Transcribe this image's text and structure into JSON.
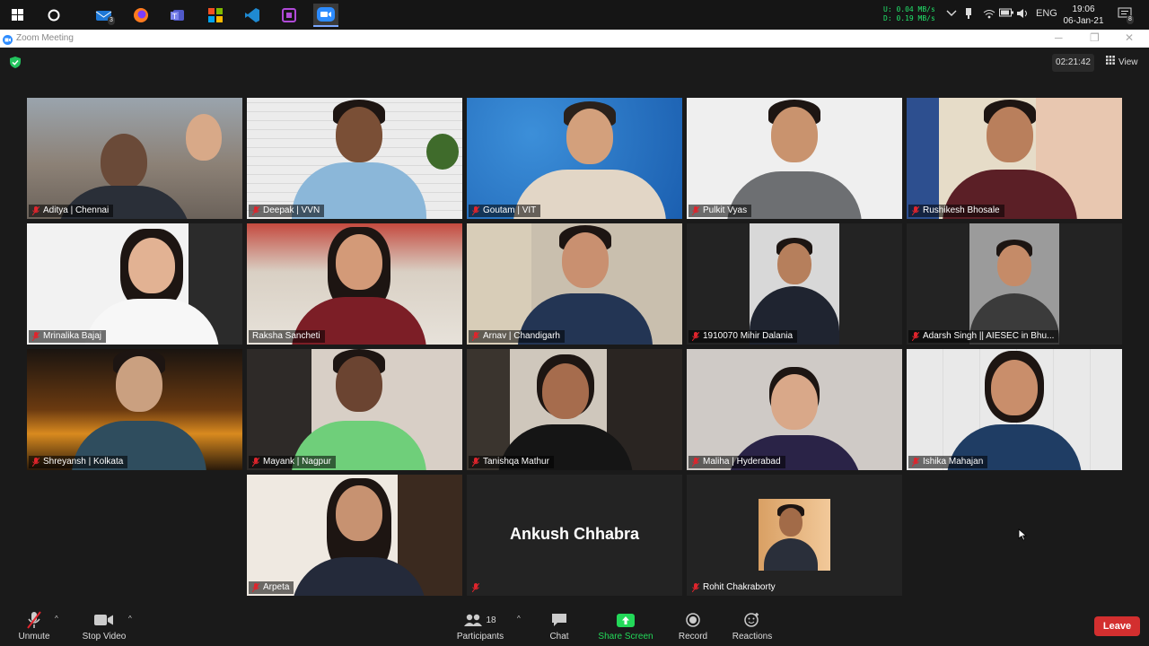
{
  "taskbar": {
    "mail_badge": "3",
    "net_upload": "U:  0.04 MB/s",
    "net_download": "D:  0.19 MB/s",
    "language": "ENG",
    "time": "19:06",
    "date": "06-Jan-21",
    "notification_count": "8"
  },
  "window": {
    "title": "Zoom Meeting"
  },
  "meeting": {
    "timer": "02:21:42",
    "view_label": "View"
  },
  "participants": [
    {
      "name": "Aditya | Chennai"
    },
    {
      "name": "Deepak | VVN"
    },
    {
      "name": "Goutam | VIT"
    },
    {
      "name": "Pulkit Vyas"
    },
    {
      "name": "Rushikesh Bhosale"
    },
    {
      "name": "Mrinalika Bajaj"
    },
    {
      "name": "Raksha Sancheti"
    },
    {
      "name": "Arnav | Chandigarh"
    },
    {
      "name": "1910070 Mihir Dalania"
    },
    {
      "name": "Adarsh Singh || AIESEC in Bhu..."
    },
    {
      "name": "Shreyansh | Kolkata"
    },
    {
      "name": "Mayank | Nagpur"
    },
    {
      "name": "Tanishqa Mathur"
    },
    {
      "name": "Maliha | Hyderabad"
    },
    {
      "name": "Ishika Mahajan"
    },
    {
      "name": "Arpeta"
    },
    {
      "name": ""
    },
    {
      "name": "Rohit Chakraborty"
    }
  ],
  "avatar_only": {
    "display_name": "Ankush Chhabra"
  },
  "toolbar": {
    "unmute": "Unmute",
    "stop_video": "Stop Video",
    "participants": "Participants",
    "participants_count": "18",
    "chat": "Chat",
    "share_screen": "Share Screen",
    "record": "Record",
    "reactions": "Reactions",
    "leave": "Leave"
  },
  "colors": {
    "active_speaker": "#b9e86b",
    "leave": "#d32f2f",
    "share_screen": "#23d959",
    "muted": "#e0242c"
  }
}
